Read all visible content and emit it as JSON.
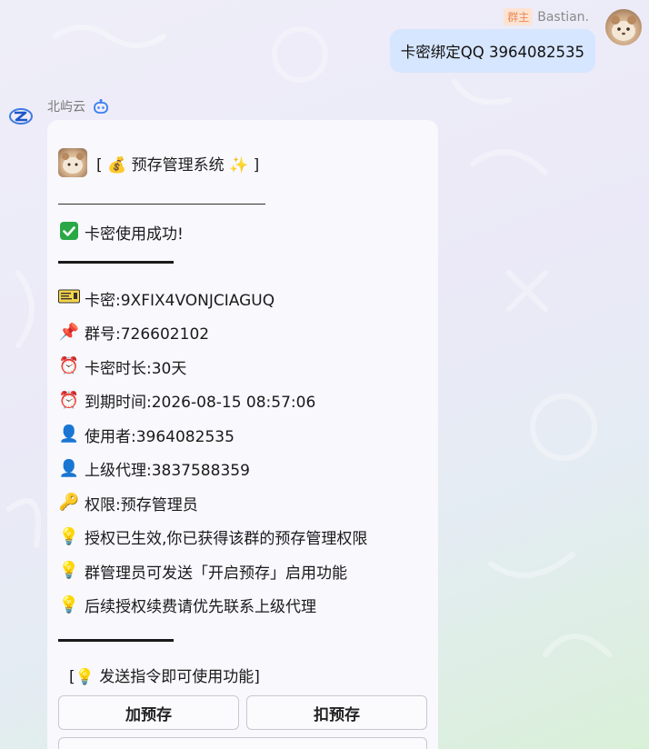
{
  "outgoing": {
    "badge": "群主",
    "sender": "Bastian.",
    "text": "卡密绑定QQ 3964082535"
  },
  "bot": {
    "name": "北屿云"
  },
  "card": {
    "title": "[ 💰 预存管理系统 ✨ ]",
    "success": "卡密使用成功!",
    "rows": [
      {
        "icon": "ticket-icon",
        "text": "卡密:9XFIX4VONJCIAGUQ"
      },
      {
        "icon": "pin-icon",
        "emoji": "📌",
        "text": "群号:726602102"
      },
      {
        "icon": "alarm-clock-icon",
        "emoji": "⏰",
        "text": "卡密时长:30天"
      },
      {
        "icon": "alarm-clock-icon",
        "emoji": "⏰",
        "text": "到期时间:2026-08-15 08:57:06"
      },
      {
        "icon": "user-icon",
        "emoji": "👤",
        "text": "使用者:3964082535"
      },
      {
        "icon": "user-icon",
        "emoji": "👤",
        "text": "上级代理:3837588359"
      },
      {
        "icon": "key-icon",
        "emoji": "🔑",
        "text": "权限:预存管理员"
      },
      {
        "icon": "bulb-icon",
        "emoji": "💡",
        "text": "授权已生效,你已获得该群的预存管理权限"
      },
      {
        "icon": "bulb-icon",
        "emoji": "💡",
        "text": "群管理员可发送「开启预存」启用功能"
      },
      {
        "icon": "bulb-icon",
        "emoji": "💡",
        "text": "后续授权续费请优先联系上级代理"
      }
    ],
    "hint": "[💡 发送指令即可使用功能]",
    "buttons": [
      "加预存",
      "扣预存"
    ]
  },
  "colors": {
    "bubble_out": "#d6e6ff",
    "badge_bg": "#fde3d2",
    "badge_text": "#e98a55",
    "card_bg": "#f8f8fd",
    "check_green": "#2aa845"
  }
}
